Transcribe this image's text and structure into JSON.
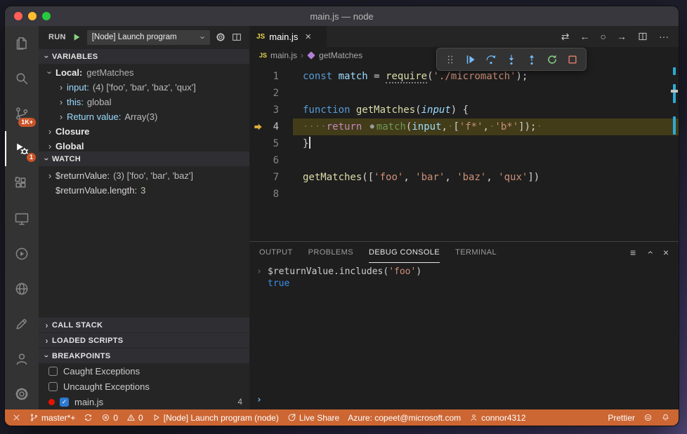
{
  "colors": {
    "status_bar_bg": "#CC6633",
    "activity_badge_bg": "#CA5328",
    "current_line_highlight": "rgba(255,215,0,0.16)",
    "accent_blue": "#75BEFF",
    "accent_green": "#89D185",
    "accent_red": "#F48771",
    "watch_number_green": "#B5CEA8",
    "console_result_blue": "#3B8EEA"
  },
  "window": {
    "title": "main.js — node"
  },
  "activity_bar": {
    "top": [
      {
        "id": "explorer",
        "icon": "files-icon",
        "badge": "",
        "active": false
      },
      {
        "id": "search",
        "icon": "search-icon",
        "badge": "",
        "active": false
      },
      {
        "id": "source-control",
        "icon": "source-control-icon",
        "badge": "1K+",
        "active": false
      },
      {
        "id": "run-and-debug",
        "icon": "debug-icon",
        "badge": "1",
        "active": true
      },
      {
        "id": "extensions",
        "icon": "extensions-icon",
        "badge": "",
        "active": false
      },
      {
        "id": "remote-explorer",
        "icon": "remote-icon",
        "badge": "",
        "active": false
      },
      {
        "id": "test-explorer",
        "icon": "test-icon",
        "badge": "",
        "active": false
      },
      {
        "id": "ports",
        "icon": "globe-icon",
        "badge": "",
        "active": false
      },
      {
        "id": "github",
        "icon": "edit-icon",
        "badge": "",
        "active": false
      }
    ],
    "bottom": [
      {
        "id": "accounts",
        "icon": "account-icon"
      },
      {
        "id": "settings",
        "icon": "gear-icon"
      }
    ]
  },
  "run_bar": {
    "label": "RUN",
    "config": "[Node] Launch program"
  },
  "variables": {
    "title": "VARIABLES",
    "rows": [
      {
        "indent": 1,
        "chevron": "down",
        "kind": "scope",
        "name": "Local:",
        "value": "getMatches"
      },
      {
        "indent": 2,
        "chevron": "right",
        "kind": "var",
        "name": "input:",
        "value": "(4) ['foo', 'bar', 'baz', 'qux']"
      },
      {
        "indent": 2,
        "chevron": "right",
        "kind": "var",
        "name": "this:",
        "value": "global"
      },
      {
        "indent": 2,
        "chevron": "right",
        "kind": "var",
        "name": "Return value:",
        "value": "Array(3)"
      },
      {
        "indent": 1,
        "chevron": "right",
        "kind": "scope",
        "name": "Closure",
        "value": ""
      },
      {
        "indent": 1,
        "chevron": "right",
        "kind": "scope",
        "name": "Global",
        "value": ""
      }
    ]
  },
  "watch": {
    "title": "WATCH",
    "rows": [
      {
        "chevron": "right",
        "name": "$returnValue:",
        "value": "(3) ['foo', 'bar', 'baz']",
        "numeric": false
      },
      {
        "chevron": "none",
        "name": "$returnValue.length:",
        "value": "3",
        "numeric": true
      }
    ]
  },
  "collapsed_sections": [
    {
      "title": "CALL STACK"
    },
    {
      "title": "LOADED SCRIPTS"
    }
  ],
  "breakpoints": {
    "title": "BREAKPOINTS",
    "rows": [
      {
        "checked": false,
        "dot": false,
        "label": "Caught Exceptions",
        "line": ""
      },
      {
        "checked": false,
        "dot": false,
        "label": "Uncaught Exceptions",
        "line": ""
      },
      {
        "checked": true,
        "dot": true,
        "label": "main.js",
        "line": "4"
      }
    ]
  },
  "editor": {
    "tab": {
      "label": "main.js"
    },
    "tab_actions": [
      {
        "id": "compare",
        "icon": "compare-icon"
      },
      {
        "id": "navigate-back",
        "icon": "nav-back-icon"
      },
      {
        "id": "open-changes",
        "icon": "circle-icon"
      },
      {
        "id": "navigate-forward",
        "icon": "nav-forward-icon"
      },
      {
        "id": "split-editor",
        "icon": "split-editor-icon"
      },
      {
        "id": "more-actions",
        "icon": "more-icon"
      }
    ],
    "breadcrumbs": [
      {
        "label": "main.js"
      },
      {
        "label": "getMatches"
      }
    ],
    "debug_toolbar": [
      {
        "id": "drag-handle",
        "icon": "gripper-icon",
        "color": "gray"
      },
      {
        "id": "continue",
        "icon": "continue-icon",
        "color": "blue"
      },
      {
        "id": "step-over",
        "icon": "step-over-icon",
        "color": "blue"
      },
      {
        "id": "step-into",
        "icon": "step-into-icon",
        "color": "blue"
      },
      {
        "id": "step-out",
        "icon": "step-out-icon",
        "color": "blue"
      },
      {
        "id": "restart",
        "icon": "restart-icon",
        "color": "green"
      },
      {
        "id": "stop",
        "icon": "stop-icon",
        "color": "red"
      }
    ],
    "lines": [
      {
        "num": 1,
        "current": false,
        "caret": false,
        "tokens": [
          [
            "const",
            "kw"
          ],
          [
            " ",
            "pun"
          ],
          [
            "match",
            "var"
          ],
          [
            " = ",
            "pun"
          ],
          [
            "require",
            "fn dotted"
          ],
          [
            "(",
            "pun"
          ],
          [
            "'./micromatch'",
            "str"
          ],
          [
            ");",
            "pun"
          ]
        ]
      },
      {
        "num": 2,
        "current": false,
        "caret": false,
        "tokens": []
      },
      {
        "num": 3,
        "current": false,
        "caret": false,
        "tokens": [
          [
            "function",
            "kw"
          ],
          [
            " ",
            "pun"
          ],
          [
            "getMatches",
            "fn"
          ],
          [
            "(",
            "pun"
          ],
          [
            "input",
            "param"
          ],
          [
            ") {",
            "pun"
          ]
        ]
      },
      {
        "num": 4,
        "current": true,
        "caret": false,
        "tokens": [
          [
            "····",
            "ws"
          ],
          [
            "return",
            "ctrl"
          ],
          [
            " ",
            "pun"
          ],
          [
            "●",
            "bpdot"
          ],
          [
            "match",
            "green"
          ],
          [
            "(",
            "pun"
          ],
          [
            "input",
            "var"
          ],
          [
            ",",
            "pun"
          ],
          [
            "·",
            "ws"
          ],
          [
            "[",
            "pun"
          ],
          [
            "'f*'",
            "str"
          ],
          [
            ",",
            "pun"
          ],
          [
            "·",
            "ws"
          ],
          [
            "'b*'",
            "str"
          ],
          [
            "]);",
            "pun"
          ],
          [
            "·",
            "ws"
          ]
        ]
      },
      {
        "num": 5,
        "current": false,
        "caret": true,
        "tokens": [
          [
            "}",
            "pun"
          ]
        ]
      },
      {
        "num": 6,
        "current": false,
        "caret": false,
        "tokens": []
      },
      {
        "num": 7,
        "current": false,
        "caret": false,
        "tokens": [
          [
            "getMatches",
            "fn"
          ],
          [
            "([",
            "pun"
          ],
          [
            "'foo'",
            "str"
          ],
          [
            ", ",
            "pun"
          ],
          [
            "'bar'",
            "str"
          ],
          [
            ", ",
            "pun"
          ],
          [
            "'baz'",
            "str"
          ],
          [
            ", ",
            "pun"
          ],
          [
            "'qux'",
            "str"
          ],
          [
            "])",
            "pun"
          ]
        ]
      },
      {
        "num": 8,
        "current": false,
        "caret": false,
        "tokens": []
      }
    ]
  },
  "panel": {
    "tabs": [
      {
        "label": "OUTPUT",
        "active": false
      },
      {
        "label": "PROBLEMS",
        "active": false
      },
      {
        "label": "DEBUG CONSOLE",
        "active": true
      },
      {
        "label": "TERMINAL",
        "active": false
      }
    ],
    "actions": [
      {
        "id": "filter",
        "icon": "filter-icon"
      },
      {
        "id": "maximize-panel",
        "icon": "chevron-up-icon"
      },
      {
        "id": "close-panel",
        "icon": "close-icon"
      }
    ],
    "console": [
      {
        "type": "input",
        "tokens": [
          [
            "$returnValue.includes(",
            "fg"
          ],
          [
            "'foo'",
            "str"
          ],
          [
            ")",
            "fg"
          ]
        ]
      },
      {
        "type": "result",
        "text": "true"
      }
    ]
  },
  "status_bar": {
    "left": [
      {
        "id": "remote",
        "icon": "remote-x-icon",
        "label": ""
      },
      {
        "id": "git-branch",
        "icon": "branch-icon",
        "label": "master*+"
      },
      {
        "id": "sync",
        "icon": "sync-icon",
        "label": ""
      },
      {
        "id": "errors",
        "icon": "error-icon",
        "label": "0"
      },
      {
        "id": "warnings",
        "icon": "warning-icon",
        "label": "0"
      },
      {
        "id": "debug-launch",
        "icon": "play-outline-icon",
        "label": "[Node] Launch program (node)"
      },
      {
        "id": "live-share",
        "icon": "live-share-icon",
        "label": "Live Share"
      },
      {
        "id": "azure-account",
        "icon": "",
        "label": "Azure: copeet@microsoft.com"
      },
      {
        "id": "github-account",
        "icon": "person-icon",
        "label": "connor4312"
      }
    ],
    "right": [
      {
        "id": "prettier",
        "icon": "",
        "label": "Prettier"
      },
      {
        "id": "feedback",
        "icon": "feedback-icon",
        "label": ""
      },
      {
        "id": "notifications",
        "icon": "bell-icon",
        "label": ""
      }
    ]
  }
}
